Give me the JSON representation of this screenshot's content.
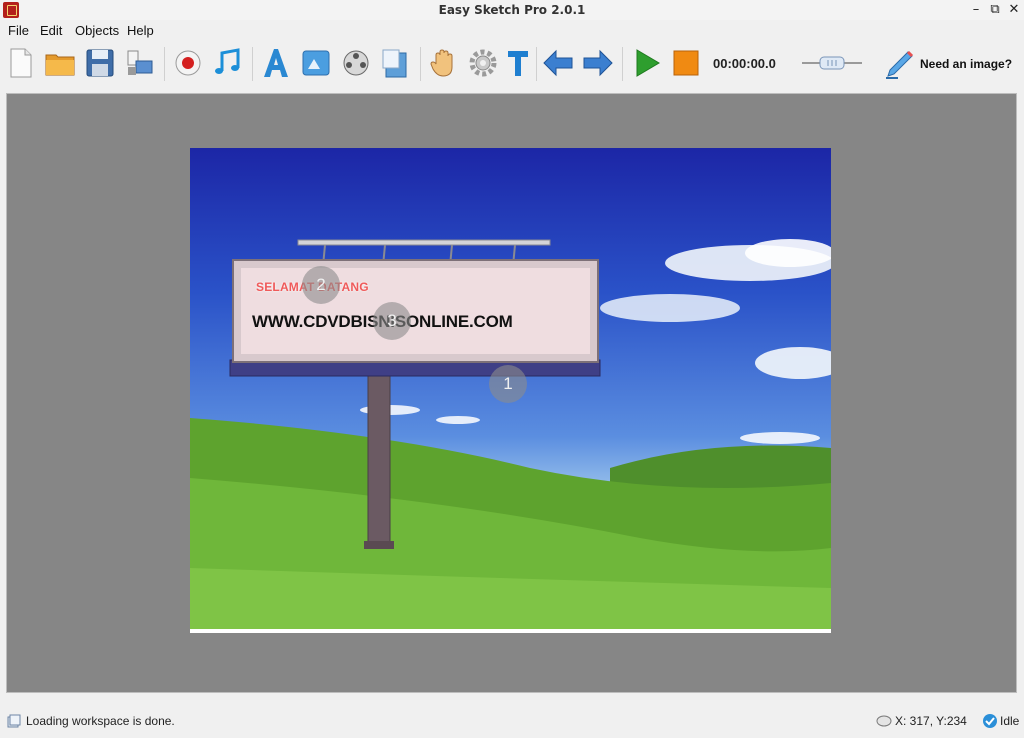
{
  "window": {
    "title": "Easy Sketch Pro 2.0.1"
  },
  "menu": {
    "items": [
      "File",
      "Edit",
      "Objects",
      "Help"
    ]
  },
  "toolbar": {
    "timer": "00:00:00.0",
    "need_image_label": "Need an image?"
  },
  "canvas": {
    "billboard": {
      "line1": "SELAMAT DATANG",
      "line2": "WWW.CDVDBISNISONLINE.COM"
    },
    "markers": [
      "1",
      "2",
      "3"
    ]
  },
  "status": {
    "message": "Loading workspace is done.",
    "coords": "X: 317, Y:234",
    "state": "Idle"
  },
  "colors": {
    "workspace_bg": "#868686",
    "accent_green": "#2e9e2e",
    "accent_orange": "#f08a12"
  }
}
